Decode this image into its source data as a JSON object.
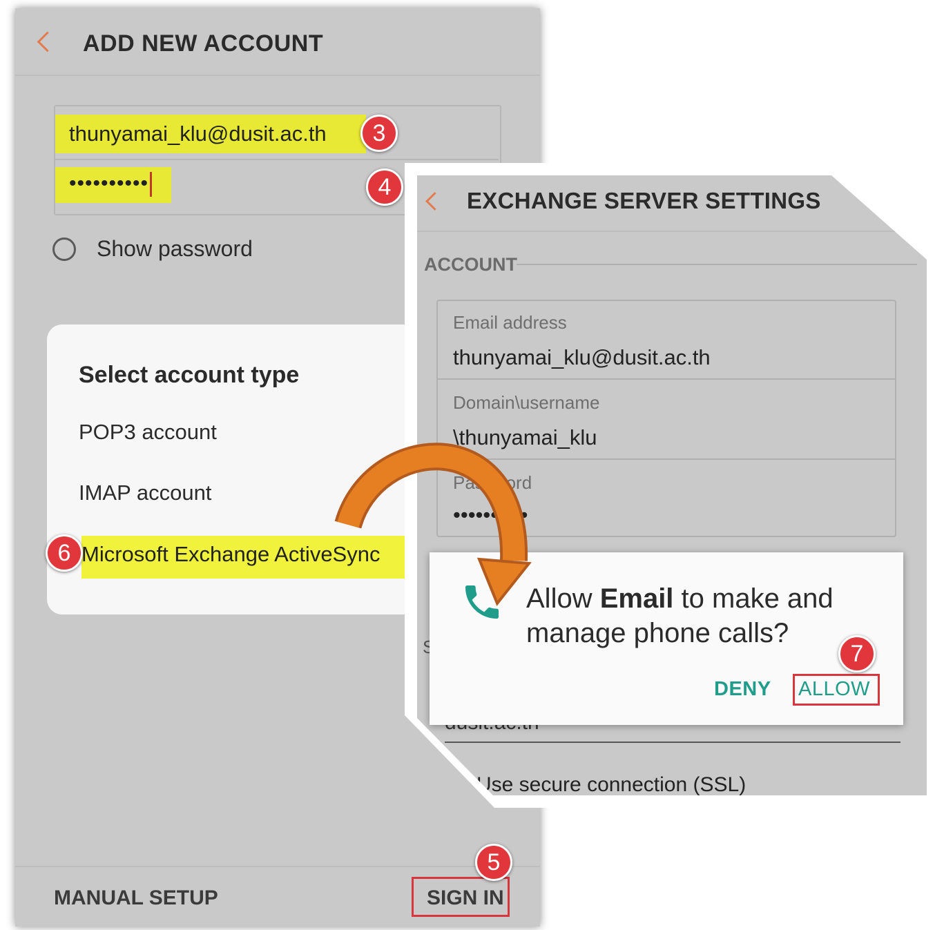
{
  "left_screen": {
    "title": "ADD NEW ACCOUNT",
    "email_value": "thunyamai_klu@dusit.ac.th",
    "password_value": "••••••••••",
    "show_password_label": "Show password",
    "account_type_dialog": {
      "title": "Select account type",
      "options": [
        "POP3 account",
        "IMAP account",
        "Microsoft Exchange ActiveSync"
      ]
    },
    "footer": {
      "manual_setup_label": "MANUAL SETUP",
      "sign_in_label": "SIGN IN"
    }
  },
  "right_screen": {
    "title": "EXCHANGE SERVER SETTINGS",
    "section_label": "ACCOUNT",
    "fields": [
      {
        "label": "Email address",
        "value": "thunyamai_klu@dusit.ac.th"
      },
      {
        "label": "Domain\\username",
        "value": "\\thunyamai_klu"
      },
      {
        "label": "Password",
        "value": "••••••••••"
      }
    ],
    "partial_text_1": "S",
    "partial_text_2": "dusit.ac.th",
    "ssl_label": "Use secure connection (SSL)"
  },
  "permission_dialog": {
    "message_prefix": "Allow ",
    "message_app": "Email",
    "message_suffix": " to make and manage phone calls?",
    "deny_label": "DENY",
    "allow_label": "ALLOW"
  },
  "step_badges": [
    "3",
    "4",
    "5",
    "6",
    "7"
  ],
  "colors": {
    "screen_bg": "#c9c9c9",
    "highlight": "#e7e935",
    "badge": "#e1373c",
    "accent_back": "#e27b4f",
    "dialog_button": "#1f9c8a",
    "arrow": "#e67e22"
  },
  "icons": {
    "back": "chevron-left-icon",
    "phone": "phone-icon",
    "arrow": "curved-arrow-icon"
  }
}
